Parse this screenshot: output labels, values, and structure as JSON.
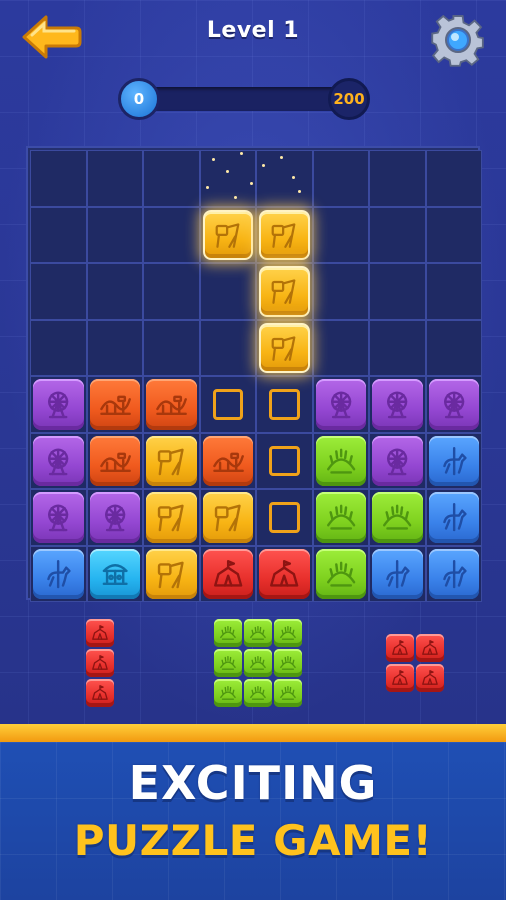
{
  "header": {
    "title": "Level 1"
  },
  "progress": {
    "current_label": "0",
    "target_label": "200",
    "fraction": 0.0
  },
  "colors": {
    "purple": "#9447d2",
    "orange": "#f05a1e",
    "yellow": "#f8b414",
    "green": "#7fd11f",
    "blue": "#3a82ea",
    "cyan": "#26b4f0",
    "red": "#e8302c",
    "outline": "#f0a21a",
    "accent_gold": "#ffc21d"
  },
  "icons": {
    "purple": "ferris-wheel-icon",
    "orange": "roller-coaster-icon",
    "yellow": "swing-ride-icon",
    "green": "bumper-ride-icon",
    "blue": "carousel-horse-icon",
    "cyan": "carousel-icon",
    "red": "circus-tent-icon"
  },
  "board": {
    "size": 8,
    "rows": [
      [
        ".",
        ".",
        ".",
        ".",
        ".",
        ".",
        ".",
        "."
      ],
      [
        ".",
        ".",
        ".",
        "G",
        "G",
        ".",
        ".",
        "."
      ],
      [
        ".",
        ".",
        ".",
        ".",
        "G",
        ".",
        ".",
        "."
      ],
      [
        ".",
        ".",
        ".",
        ".",
        "G",
        ".",
        ".",
        "."
      ],
      [
        "purple",
        "orange",
        "orange",
        "O",
        "O",
        "purple",
        "purple",
        "purple"
      ],
      [
        "purple",
        "orange",
        "yellow",
        "orange",
        "O",
        "green",
        "purple",
        "blue"
      ],
      [
        "purple",
        "purple",
        "yellow",
        "yellow",
        "O",
        "green",
        "green",
        "blue"
      ],
      [
        "blue",
        "cyan",
        "yellow",
        "red",
        "red",
        "green",
        "blue",
        "blue"
      ]
    ],
    "legend": {
      ".": "empty",
      "G": "glowing dragged piece",
      "O": "placement outline"
    }
  },
  "tray": [
    {
      "color": "red",
      "shape": [
        [
          1
        ],
        [
          1
        ],
        [
          1
        ]
      ]
    },
    {
      "color": "green",
      "shape": [
        [
          1,
          1,
          1
        ],
        [
          1,
          1,
          1
        ],
        [
          1,
          1,
          1
        ]
      ]
    },
    {
      "color": "red",
      "shape": [
        [
          1,
          1
        ],
        [
          1,
          1
        ]
      ]
    }
  ],
  "banner": {
    "line1": "EXCITING",
    "line2": "PUZZLE GAME!"
  }
}
